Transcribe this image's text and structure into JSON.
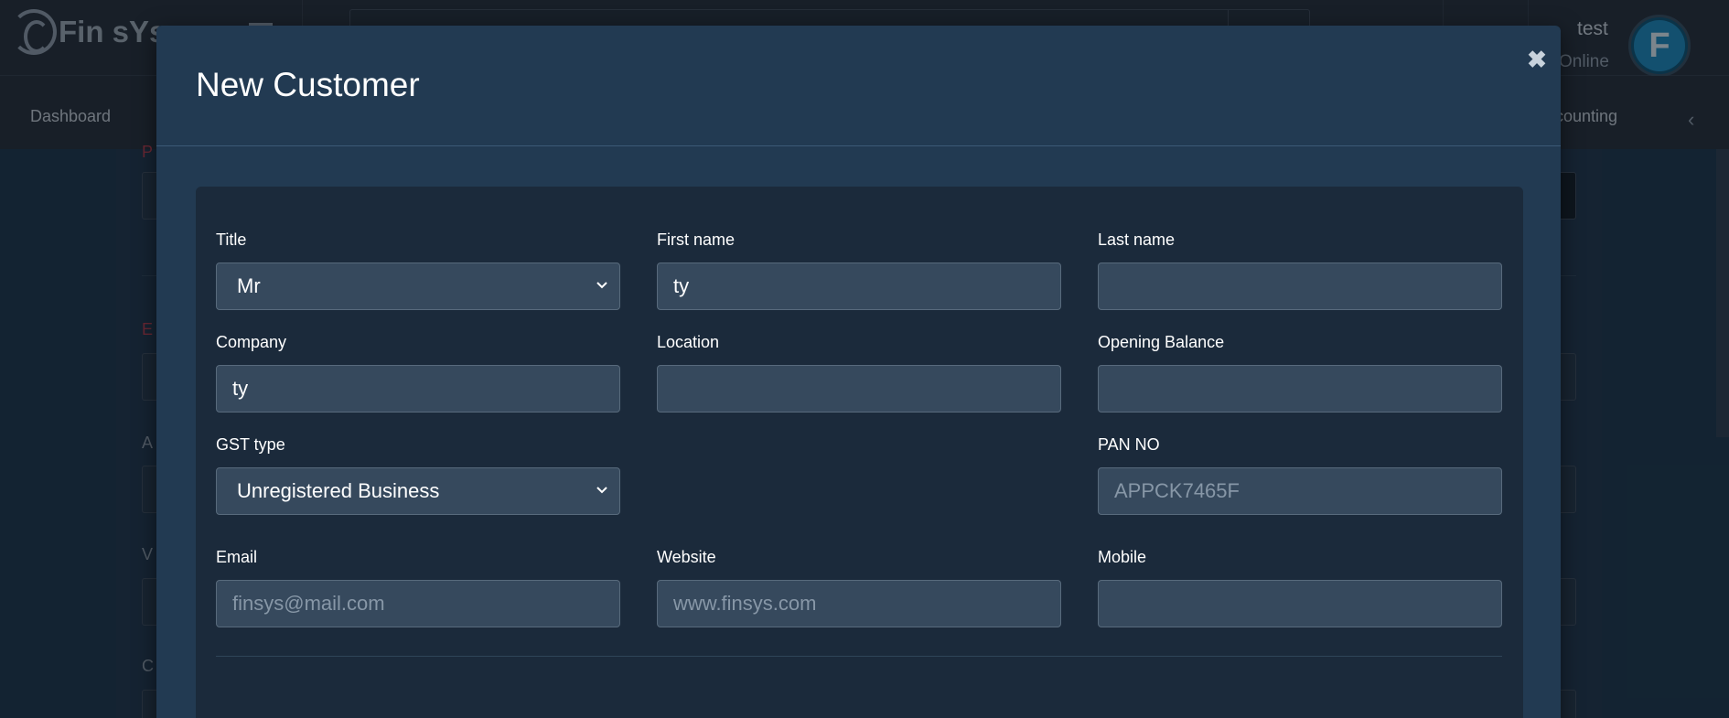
{
  "app": {
    "logo_text": "Fin sYs",
    "user": {
      "name": "test",
      "status": "Online",
      "avatar_letter": "F"
    }
  },
  "nav": {
    "items": [
      "Dashboard",
      "counting"
    ]
  },
  "modal": {
    "title": "New Customer",
    "close_icon": "close-icon",
    "fields": {
      "title": {
        "label": "Title",
        "value": "Mr"
      },
      "first_name": {
        "label": "First name",
        "value": "ty"
      },
      "last_name": {
        "label": "Last name",
        "value": ""
      },
      "company": {
        "label": "Company",
        "value": "ty"
      },
      "location": {
        "label": "Location",
        "value": ""
      },
      "opening_balance": {
        "label": "Opening Balance",
        "value": ""
      },
      "gst_type": {
        "label": "GST type",
        "value": "Unregistered Business"
      },
      "pan_no": {
        "label": "PAN NO",
        "placeholder": "APPCK7465F",
        "value": ""
      },
      "email": {
        "label": "Email",
        "placeholder": "finsys@mail.com",
        "value": ""
      },
      "website": {
        "label": "Website",
        "placeholder": "www.finsys.com",
        "value": ""
      },
      "mobile": {
        "label": "Mobile",
        "value": ""
      }
    }
  },
  "colors": {
    "modal_bg": "#223a52",
    "card_bg": "#1b2a3b",
    "field_bg": "#36495d",
    "accent_red": "#b23a48"
  }
}
